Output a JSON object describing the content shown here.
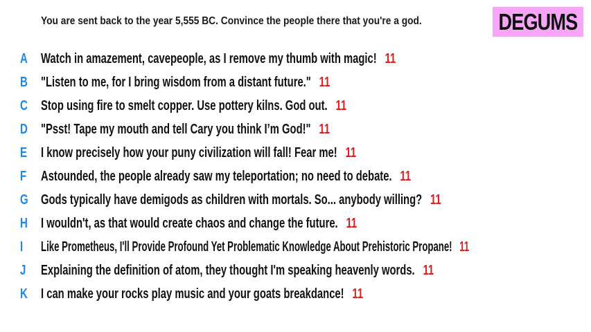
{
  "prompt": "You are sent back to the year 5,555 BC. Convince the people there that you're a god.",
  "logo": "DEGUMS",
  "colors": {
    "letter": "#1e88e5",
    "score": "#e41c1c",
    "logo_bg": "#f7a6f7"
  },
  "answers": [
    {
      "letter": "A",
      "text": "Watch in amazement, cavepeople, as I remove my thumb with magic!",
      "score": "11"
    },
    {
      "letter": "B",
      "text": "\"Listen to me, for I bring wisdom from a distant future.\"",
      "score": "11"
    },
    {
      "letter": "C",
      "text": "Stop using fire to smelt copper. Use pottery kilns. God out.",
      "score": "11"
    },
    {
      "letter": "D",
      "text": "\"Psst! Tape my mouth and tell Cary you think I’m God!\"",
      "score": "11"
    },
    {
      "letter": "E",
      "text": "I know precisely how your puny civilization will fall! Fear me!",
      "score": "11"
    },
    {
      "letter": "F",
      "text": "Astounded, the people already saw my teleportation; no need to debate.",
      "score": "11"
    },
    {
      "letter": "G",
      "text": "Gods typically have demigods as children with mortals. So... anybody willing?",
      "score": "11"
    },
    {
      "letter": "H",
      "text": "I wouldn't, as that would create chaos and change the future.",
      "score": "11"
    },
    {
      "letter": "I",
      "text": "Like Prometheus, I'll Provide Profound Yet Problematic Knowledge About Prehistoric Propane!",
      "score": "11"
    },
    {
      "letter": "J",
      "text": "Explaining the definition of atom, they thought I'm speaking heavenly words.",
      "score": "11"
    },
    {
      "letter": "K",
      "text": "I can make your rocks play music and your goats breakdance!",
      "score": "11"
    }
  ]
}
